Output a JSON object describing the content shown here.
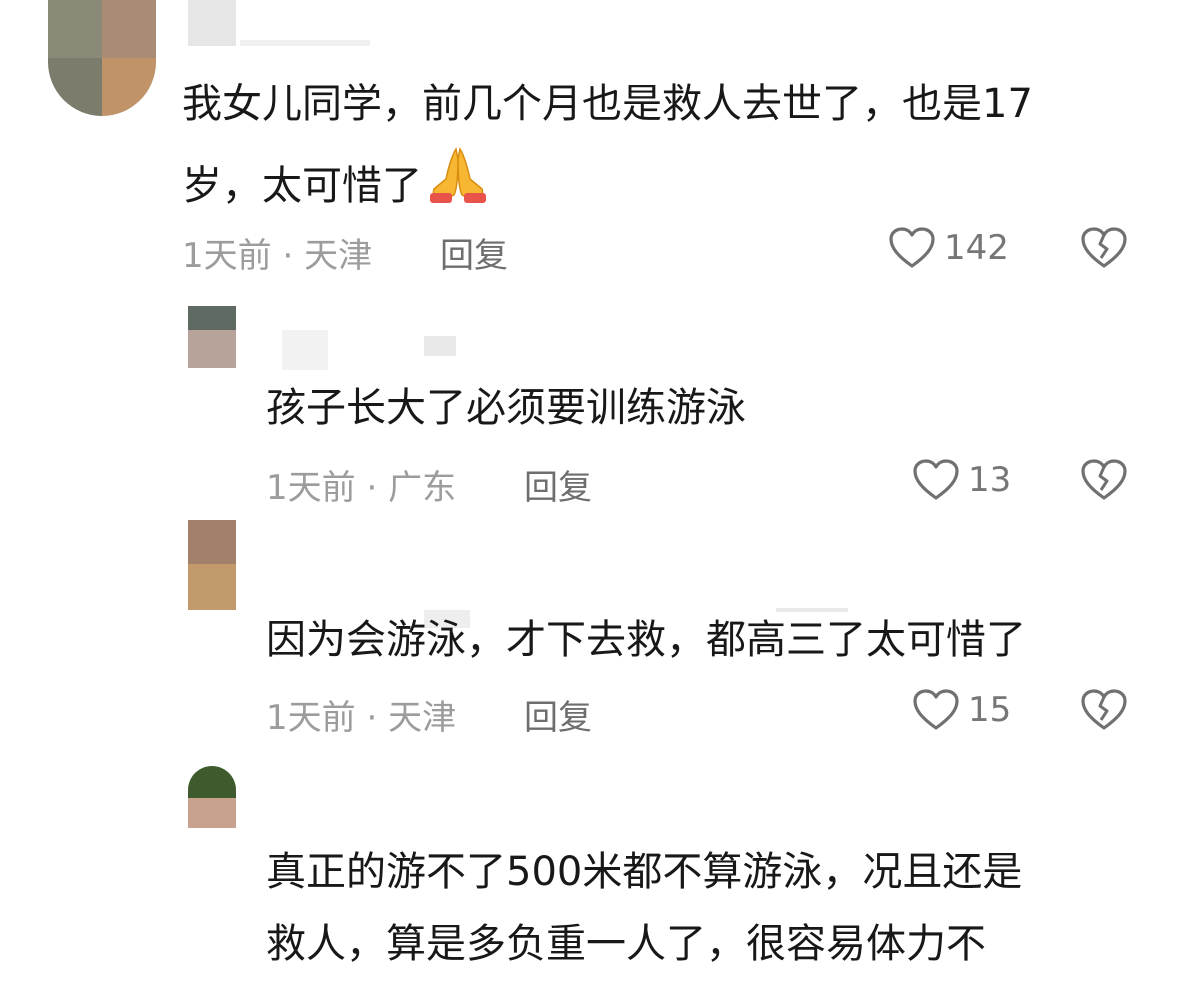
{
  "comments": [
    {
      "text_lines": [
        "我女儿同学，前几个月也是救人去世了，也是17",
        "岁，太可惜了"
      ],
      "emoji": "praying-hands",
      "time": "1天前",
      "location": "天津",
      "reply_label": "回复",
      "likes": "142"
    },
    {
      "text_lines": [
        "孩子长大了必须要训练游泳"
      ],
      "time": "1天前",
      "location": "广东",
      "reply_label": "回复",
      "likes": "13"
    },
    {
      "text_lines": [
        "因为会游泳，才下去救，都高三了太可惜了"
      ],
      "time": "1天前",
      "location": "天津",
      "reply_label": "回复",
      "likes": "15"
    },
    {
      "text_lines": [
        "真正的游不了500米都不算游泳，况且还是",
        "救人，算是多负重一人了，很容易体力不"
      ],
      "time": "",
      "location": "",
      "reply_label": "",
      "likes": ""
    }
  ],
  "icons": {
    "like": "heart-outline-icon",
    "dislike": "broken-heart-icon"
  },
  "colors": {
    "text": "#181818",
    "meta": "#9c9c9c",
    "icon": "#707070"
  }
}
